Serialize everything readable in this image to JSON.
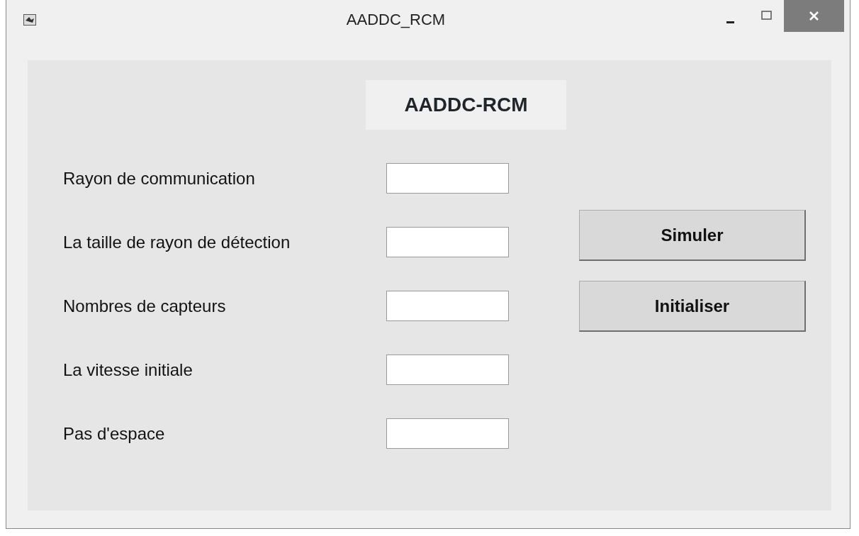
{
  "window": {
    "title": "AADDC_RCM"
  },
  "heading": "AADDC-RCM",
  "fields": [
    {
      "label": "Rayon de communication"
    },
    {
      "label": "La taille de rayon de détection"
    },
    {
      "label": "Nombres de capteurs"
    },
    {
      "label": "La vitesse initiale"
    },
    {
      "label": "Pas d'espace"
    }
  ],
  "buttons": [
    "Simuler",
    "Initialiser"
  ]
}
